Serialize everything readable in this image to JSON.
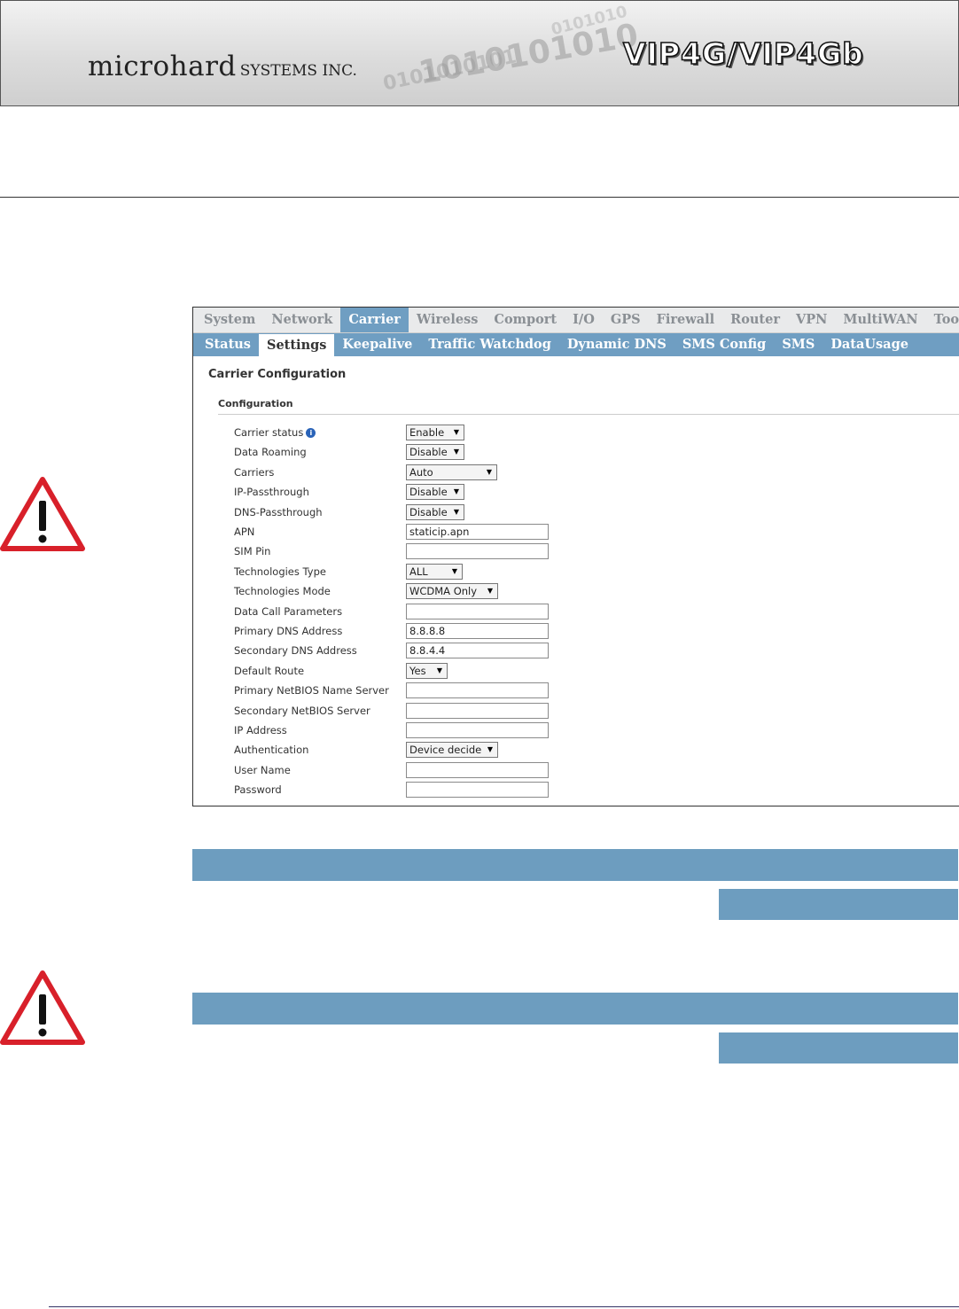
{
  "banner": {
    "logo": "microhard",
    "logo_sub": "SYSTEMS INC.",
    "model": "VIP4G/VIP4Gb",
    "digits_1": "1010101010",
    "digits_2": "0101010101",
    "digits_3": "0101010"
  },
  "nav": {
    "items": [
      {
        "label": "System"
      },
      {
        "label": "Network"
      },
      {
        "label": "Carrier",
        "active": true
      },
      {
        "label": "Wireless"
      },
      {
        "label": "Comport"
      },
      {
        "label": "I/O"
      },
      {
        "label": "GPS"
      },
      {
        "label": "Firewall"
      },
      {
        "label": "Router"
      },
      {
        "label": "VPN"
      },
      {
        "label": "MultiWAN"
      },
      {
        "label": "Tools"
      }
    ]
  },
  "subnav": {
    "tabs": [
      {
        "label": "Status"
      },
      {
        "label": "Settings",
        "active": true
      },
      {
        "label": "Keepalive"
      },
      {
        "label": "Traffic Watchdog"
      },
      {
        "label": "Dynamic DNS"
      },
      {
        "label": "SMS Config"
      },
      {
        "label": "SMS"
      },
      {
        "label": "DataUsage"
      }
    ]
  },
  "page": {
    "title": "Carrier Configuration",
    "section": "Configuration",
    "info_glyph": "i"
  },
  "fields": [
    {
      "label": "Carrier status",
      "type": "select",
      "value": "Enable",
      "info": true
    },
    {
      "label": "Data Roaming",
      "type": "select",
      "value": "Disable"
    },
    {
      "label": "Carriers",
      "type": "select",
      "value": "Auto"
    },
    {
      "label": "IP-Passthrough",
      "type": "select",
      "value": "Disable"
    },
    {
      "label": "DNS-Passthrough",
      "type": "select",
      "value": "Disable"
    },
    {
      "label": "APN",
      "type": "text",
      "value": "staticip.apn"
    },
    {
      "label": "SIM Pin",
      "type": "text",
      "value": ""
    },
    {
      "label": "Technologies Type",
      "type": "select",
      "value": "ALL"
    },
    {
      "label": "Technologies Mode",
      "type": "select",
      "value": "WCDMA Only"
    },
    {
      "label": "Data Call Parameters",
      "type": "text",
      "value": ""
    },
    {
      "label": "Primary DNS Address",
      "type": "text",
      "value": "8.8.8.8"
    },
    {
      "label": "Secondary DNS Address",
      "type": "text",
      "value": "8.8.4.4"
    },
    {
      "label": "Default Route",
      "type": "select",
      "value": "Yes"
    },
    {
      "label": "Primary NetBIOS Name Server",
      "type": "text",
      "value": ""
    },
    {
      "label": "Secondary NetBIOS Server",
      "type": "text",
      "value": ""
    },
    {
      "label": "IP Address",
      "type": "text",
      "value": ""
    },
    {
      "label": "Authentication",
      "type": "select",
      "value": "Device decide"
    },
    {
      "label": "User Name",
      "type": "text",
      "value": ""
    },
    {
      "label": "Password",
      "type": "text",
      "value": ""
    }
  ],
  "icons": {
    "warning_1": "warning-icon",
    "warning_2": "warning-icon",
    "select_arrow": "▼"
  },
  "colors": {
    "accent": "#6f9ec2",
    "bar": "#6d9dbf",
    "warning_red": "#d8202a"
  }
}
